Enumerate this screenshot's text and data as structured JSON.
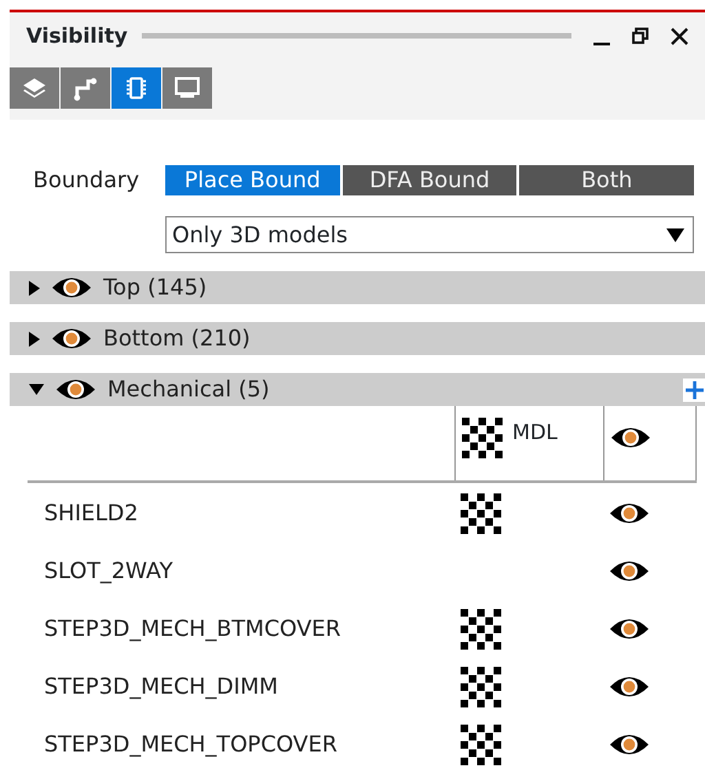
{
  "window": {
    "title": "Visibility"
  },
  "tools": [
    {
      "kind": "layers",
      "selected": false
    },
    {
      "kind": "route",
      "selected": false
    },
    {
      "kind": "chip",
      "selected": true
    },
    {
      "kind": "display",
      "selected": false
    }
  ],
  "boundary": {
    "label": "Boundary",
    "options": [
      {
        "label": "Place Bound",
        "selected": true
      },
      {
        "label": "DFA Bound",
        "selected": false
      },
      {
        "label": "Both",
        "selected": false
      }
    ]
  },
  "filter": {
    "value": "Only 3D models"
  },
  "groups": [
    {
      "label": "Top (145)",
      "expanded": false,
      "visible": true
    },
    {
      "label": "Bottom (210)",
      "expanded": false,
      "visible": true
    },
    {
      "label": "Mechanical (5)",
      "expanded": true,
      "visible": true
    }
  ],
  "table": {
    "columns": [
      {
        "kind": "model",
        "label": "MDL"
      },
      {
        "kind": "visible"
      }
    ],
    "rows": [
      {
        "name": "SHIELD2",
        "model": true,
        "visible": true
      },
      {
        "name": "SLOT_2WAY",
        "model": false,
        "visible": true
      },
      {
        "name": "STEP3D_MECH_BTMCOVER",
        "model": true,
        "visible": true
      },
      {
        "name": "STEP3D_MECH_DIMM",
        "model": true,
        "visible": true
      },
      {
        "name": "STEP3D_MECH_TOPCOVER",
        "model": true,
        "visible": true
      }
    ]
  }
}
